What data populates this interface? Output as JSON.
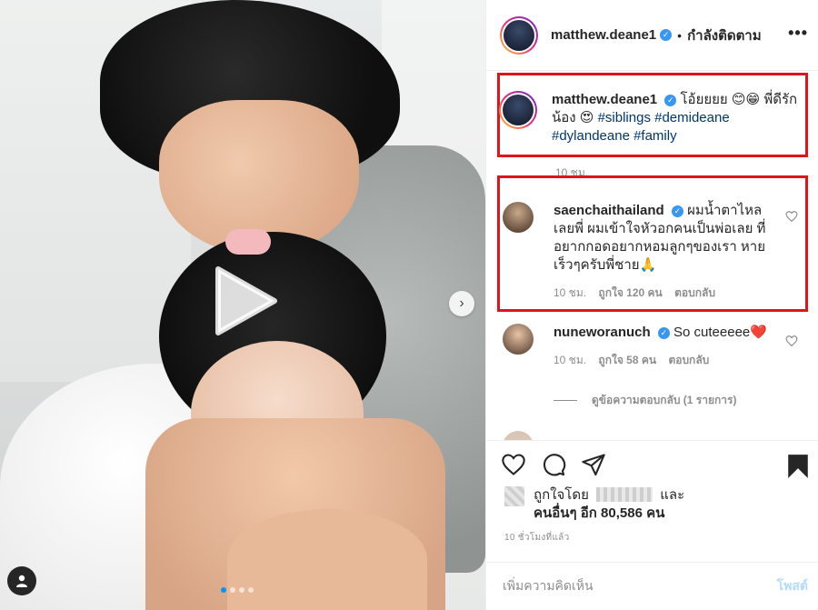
{
  "header": {
    "username": "matthew.deane1",
    "follow_status": "กำลังติดตาม",
    "separator": "•",
    "more": "•••"
  },
  "caption": {
    "username": "matthew.deane1",
    "text": "โอ้ยยยย 😊😁 พี่ดีรักน้อง 😍",
    "hashtags": "#siblings #demideane #dylandeane #family",
    "time": "10 ชม."
  },
  "comments": [
    {
      "username": "saenchaithailand",
      "text": "ผมน้ำตาไหลเลยพี่ ผมเข้าใจหัวอกคนเป็นพ่อเลย ที่อยากกอดอยากหอมลูกๆของเรา หายเร็วๆครับพี่ชาย🙏",
      "time": "10 ชม.",
      "likes": "ถูกใจ 120 คน",
      "reply": "ตอบกลับ"
    },
    {
      "username": "nuneworanuch",
      "text": "So cuteeeee❤️",
      "time": "10 ชม.",
      "likes": "ถูกใจ 58 คน",
      "reply": "ตอบกลับ",
      "view_replies": "ดูข้อความตอบกลับ (1 รายการ)"
    }
  ],
  "likes": {
    "prefix": "ถูกใจโดย",
    "suffix": "และ",
    "others": "คนอื่นๆ อีก 80,586 คน"
  },
  "post_time": "10 ชั่วโมงที่แล้ว",
  "add_comment": {
    "placeholder": "เพิ่มความคิดเห็น",
    "post_label": "โพสต์"
  },
  "colors": {
    "highlight_box": "#e0151b",
    "verified": "#3897f0",
    "hashtag": "#00376b",
    "post_button": "#b3dbff"
  }
}
